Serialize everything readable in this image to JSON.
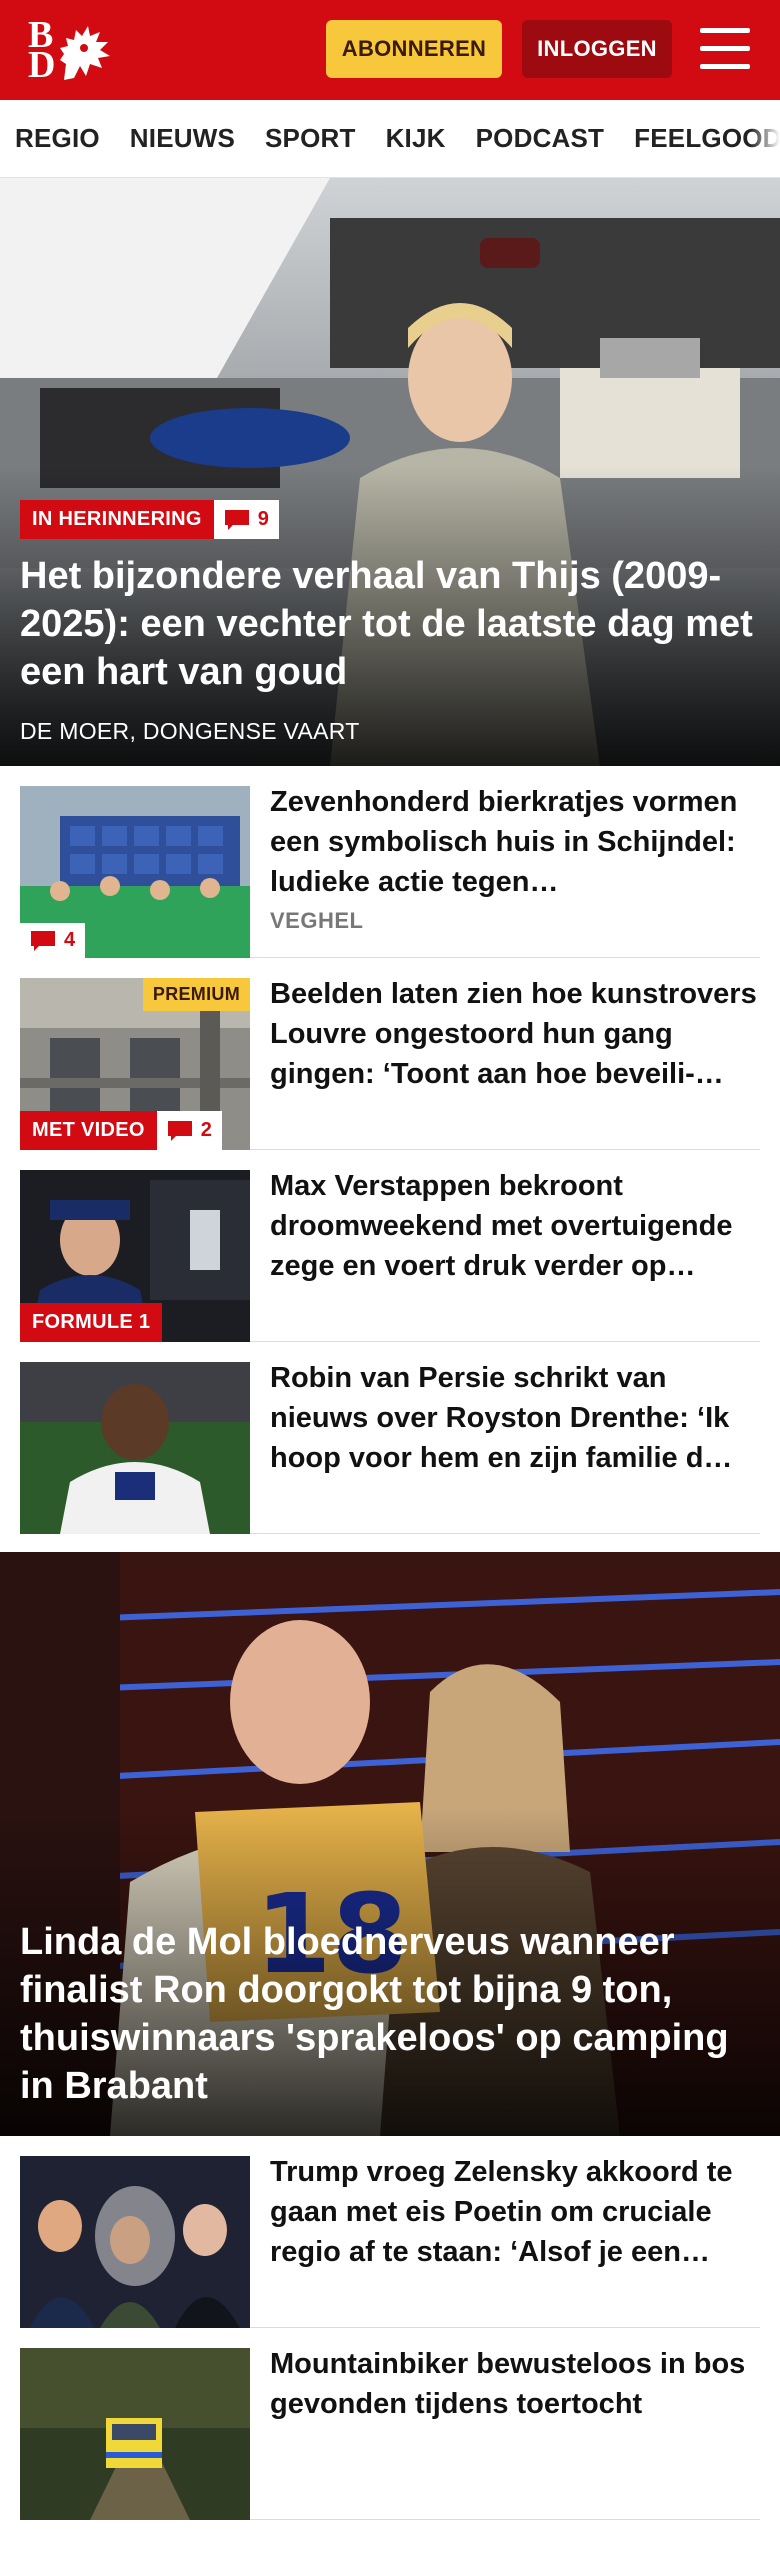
{
  "header": {
    "logo_letters": "BD",
    "subscribe_label": "ABONNEREN",
    "login_label": "INLOGGEN",
    "brand_color": "#d20a11"
  },
  "nav": {
    "items": [
      "REGIO",
      "NIEUWS",
      "SPORT",
      "KIJK",
      "PODCAST",
      "FEELGOOD"
    ]
  },
  "hero": {
    "label": "IN HERINNERING",
    "comments": "9",
    "title": "Het bijzondere verhaal van Thijs (2009-2025): een vechter tot de laatste dag met een hart van goud",
    "location": "DE MOER, DONGENSE VAART"
  },
  "articles": [
    {
      "title": "Zevenhonderd bierkratjes vormen een symbolisch huis in Schijndel: ludieke actie tegen…",
      "subtitle": "VEGHEL",
      "comments": "4"
    },
    {
      "title": "Beelden laten zien hoe kunstro­vers Louvre ongestoord hun gang gingen: ‘Toont aan hoe beveili-…",
      "premium": "PREMIUM",
      "video_label": "MET VIDEO",
      "comments": "2"
    },
    {
      "title": "Max Verstappen bekroont droomweekend met overtuigen­de zege en voert druk verder op…",
      "tag": "FORMULE 1"
    },
    {
      "title": "Robin van Persie schrikt van nieuws over Royston Drenthe: ‘Ik hoop voor hem en zijn familie d…"
    }
  ],
  "feature": {
    "title": "Linda de Mol bloednerveus wanneer finalist Ron doorgokt tot bijna 9 ton, thuiswinnaars 'sprakeloos' op camping in Brabant",
    "podium_number": "18"
  },
  "articles2": [
    {
      "title": "Trump vroeg Zelensky akkoord te gaan met eis Poetin om cruciale regio af te staan: ‘Alsof je een…"
    },
    {
      "title": "Mountainbiker bewusteloos in bos gevonden tijdens toertocht"
    }
  ]
}
